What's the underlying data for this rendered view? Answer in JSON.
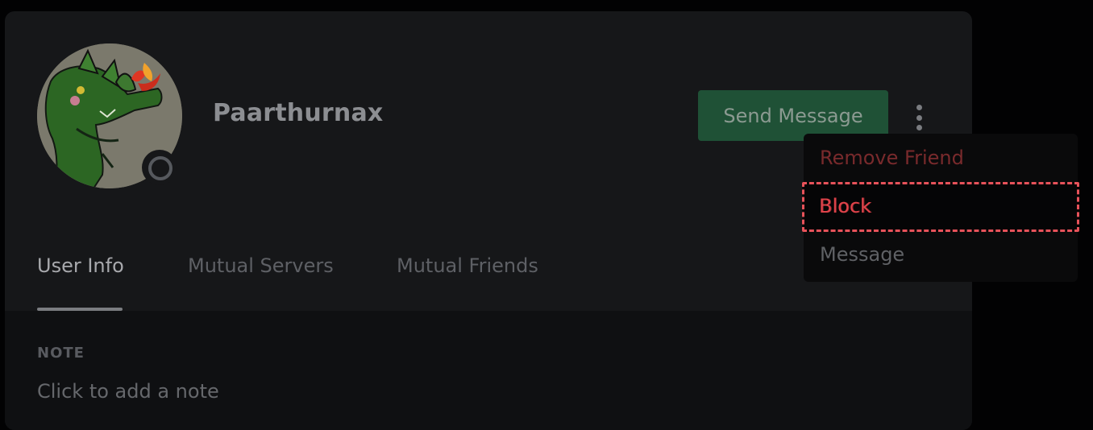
{
  "profile": {
    "username": "Paarthurnax",
    "status": "offline",
    "avatar": "green-dragon-avatar"
  },
  "actions": {
    "send_message": "Send Message",
    "more_icon": "vertical-ellipsis-icon"
  },
  "tabs": [
    {
      "label": "User Info",
      "active": true
    },
    {
      "label": "Mutual Servers",
      "active": false
    },
    {
      "label": "Mutual Friends",
      "active": false
    }
  ],
  "note": {
    "title": "NOTE",
    "placeholder": "Click to add a note"
  },
  "context_menu": {
    "items": [
      {
        "label": "Remove Friend",
        "color": "#792a2c"
      },
      {
        "label": "Block",
        "color": "#e0434a"
      },
      {
        "label": "Message",
        "color": "#5f6165"
      }
    ]
  },
  "colors": {
    "danger": "#e0434a",
    "send_button": "#1f5136",
    "background": "#161719"
  }
}
